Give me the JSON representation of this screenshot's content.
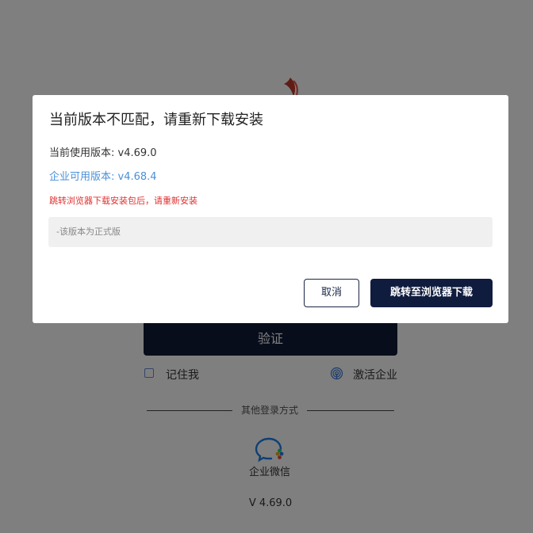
{
  "login": {
    "verify_button": "验证",
    "remember_label": "记住我",
    "activate_label": "激活企业",
    "divider_text": "其他登录方式",
    "wecom_label": "企业微信",
    "version": "V 4.69.0"
  },
  "dialog": {
    "title": "当前版本不匹配，请重新下载安装",
    "current_version": "当前使用版本: v4.69.0",
    "available_version": "企业可用版本: v4.68.4",
    "hint": "跳转浏览器下载安装包后，请重新安装",
    "notes": "-该版本为正式版",
    "cancel_label": "取消",
    "download_label": "跳转至浏览器下载"
  },
  "colors": {
    "primary_dark": "#101c3e",
    "link_blue": "#4a90d9",
    "warning_red": "#e03030",
    "mask": "rgba(0,0,0,0.5)"
  },
  "icons": {
    "logo": "logo-icon",
    "activate": "fingerprint-icon",
    "wecom": "wecom-icon",
    "checkbox": "checkbox-icon"
  }
}
